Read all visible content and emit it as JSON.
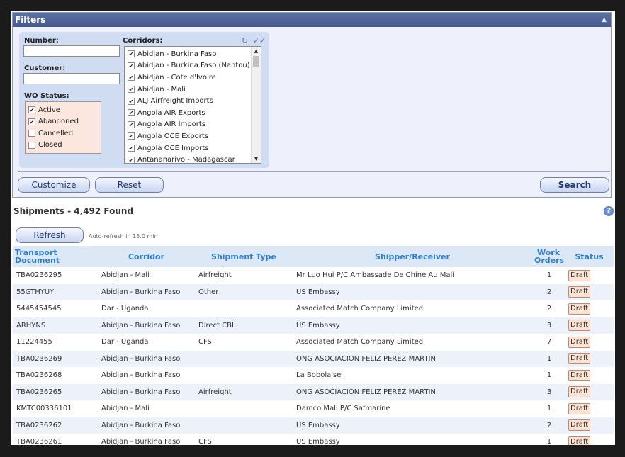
{
  "filters": {
    "title": "Filters",
    "collapse_icon": "▲",
    "number_label": "Number:",
    "number_value": "",
    "customer_label": "Customer:",
    "customer_value": "",
    "wo_status_label": "WO Status:",
    "wo_statuses": [
      {
        "label": "Active",
        "checked": true
      },
      {
        "label": "Abandoned",
        "checked": true
      },
      {
        "label": "Cancelled",
        "checked": false
      },
      {
        "label": "Closed",
        "checked": false
      }
    ],
    "corridors_label": "Corridors:",
    "corridor_icons": {
      "refresh": "↻",
      "check_all": "✓✓"
    },
    "corridors": [
      {
        "label": "Abidjan - Burkina Faso",
        "checked": true
      },
      {
        "label": "Abidjan - Burkina Faso (Nantou)",
        "checked": true
      },
      {
        "label": "Abidjan - Cote d'Ivoire",
        "checked": true
      },
      {
        "label": "Abidjan - Mali",
        "checked": true
      },
      {
        "label": "ALJ Airfreight Imports",
        "checked": true
      },
      {
        "label": "Angola AIR Exports",
        "checked": true
      },
      {
        "label": "Angola AIR Imports",
        "checked": true
      },
      {
        "label": "Angola OCE Exports",
        "checked": true
      },
      {
        "label": "Angola OCE Imports",
        "checked": true
      },
      {
        "label": "Antananarivo - Madagascar",
        "checked": true
      }
    ],
    "customize_label": "Customize",
    "reset_label": "Reset",
    "search_label": "Search"
  },
  "shipments": {
    "title": "Shipments - 4,492 Found",
    "help_icon": "?",
    "refresh_label": "Refresh",
    "auto_refresh": "Auto-refresh in 15.0 min",
    "columns": {
      "transport_document": "Transport Document",
      "corridor": "Corridor",
      "shipment_type": "Shipment Type",
      "shipper_receiver": "Shipper/Receiver",
      "work_orders": "Work Orders",
      "status": "Status"
    },
    "rows": [
      {
        "doc": "TBA0236295",
        "corridor": "Abidjan - Mali",
        "type": "Airfreight",
        "shipper": "Mr Luo Hui P/C Ambassade De Chine Au Mali",
        "wo": "1",
        "status": "Draft"
      },
      {
        "doc": "55GTHYUY",
        "corridor": "Abidjan - Burkina Faso",
        "type": "Other",
        "shipper": "US Embassy",
        "wo": "2",
        "status": "Draft"
      },
      {
        "doc": "5445454545",
        "corridor": "Dar - Uganda",
        "type": "",
        "shipper": "Associated Match Company Limited",
        "wo": "2",
        "status": "Draft"
      },
      {
        "doc": "ARHYNS",
        "corridor": "Abidjan - Burkina Faso",
        "type": "Direct CBL",
        "shipper": "US Embassy",
        "wo": "3",
        "status": "Draft"
      },
      {
        "doc": "11224455",
        "corridor": "Dar - Uganda",
        "type": "CFS",
        "shipper": "Associated Match Company Limited",
        "wo": "7",
        "status": "Draft"
      },
      {
        "doc": "TBA0236269",
        "corridor": "Abidjan - Burkina Faso",
        "type": "",
        "shipper": "ONG ASOCIACION FELIZ PEREZ MARTIN",
        "wo": "1",
        "status": "Draft"
      },
      {
        "doc": "TBA0236268",
        "corridor": "Abidjan - Burkina Faso",
        "type": "",
        "shipper": "La Bobolaise",
        "wo": "1",
        "status": "Draft"
      },
      {
        "doc": "TBA0236265",
        "corridor": "Abidjan - Burkina Faso",
        "type": "Airfreight",
        "shipper": "ONG ASOCIACION FELIZ PEREZ MARTIN",
        "wo": "3",
        "status": "Draft"
      },
      {
        "doc": "KMTC00336101",
        "corridor": "Abidjan - Mali",
        "type": "",
        "shipper": "Damco Mali P/C Safmarine",
        "wo": "1",
        "status": "Draft"
      },
      {
        "doc": "TBA0236262",
        "corridor": "Abidjan - Burkina Faso",
        "type": "",
        "shipper": "US Embassy",
        "wo": "2",
        "status": "Draft"
      },
      {
        "doc": "TBA0236261",
        "corridor": "Abidjan - Burkina Faso",
        "type": "CFS",
        "shipper": "US Embassy",
        "wo": "1",
        "status": "Draft"
      }
    ]
  }
}
